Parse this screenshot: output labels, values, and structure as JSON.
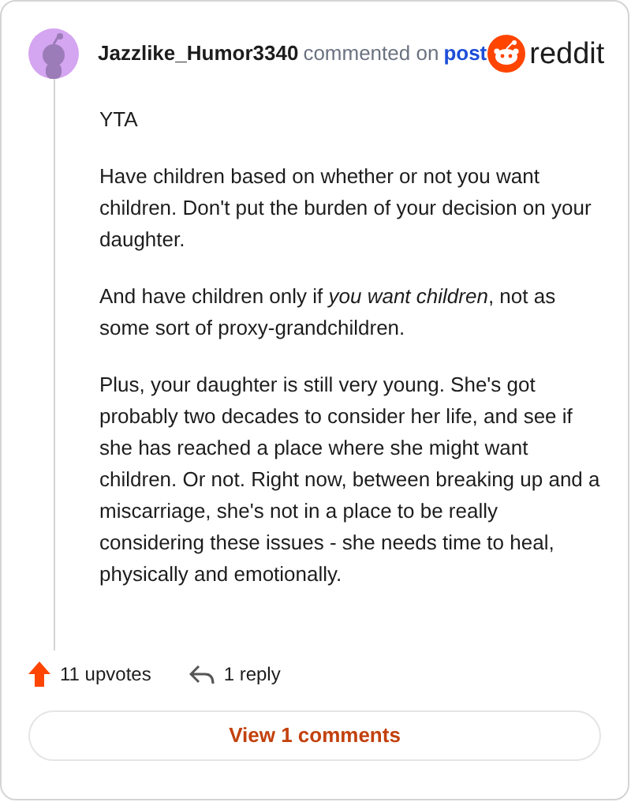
{
  "comment": {
    "author": "Jazzlike_Humor3340",
    "action": "commented on",
    "link": "post",
    "brand": "reddit",
    "paragraphs": [
      "YTA",
      "Have children based on whether or not you want children. Don't put the burden of your decision on your daughter.",
      "And have children only if *you want children*, not as some sort of proxy-grandchildren.",
      "Plus, your daughter is still very young. She's got probably two decades to consider her life, and see if she has reached a place where she might want children. Or not. Right now, between breaking up and a miscarriage, she's not in a place to be really considering these issues - she needs time to heal, physically and emotionally."
    ],
    "upvotes": "11 upvotes",
    "replies": "1 reply"
  },
  "button": "View 1 comments"
}
